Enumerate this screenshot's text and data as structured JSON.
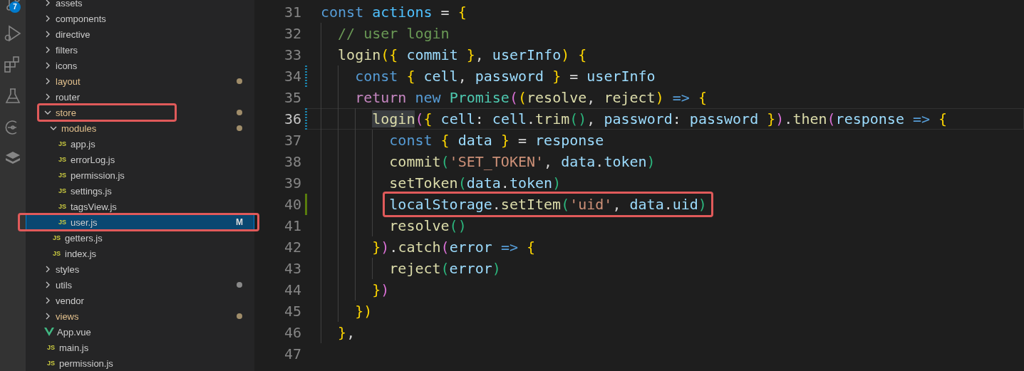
{
  "activity_bar": {
    "badge": "7"
  },
  "explorer": {
    "items": [
      {
        "name": "assets",
        "kind": "folder",
        "expanded": false,
        "modified": false,
        "dot": false,
        "selected": false,
        "annotated": false
      },
      {
        "name": "components",
        "kind": "folder",
        "expanded": false,
        "modified": false,
        "dot": false,
        "selected": false,
        "annotated": false
      },
      {
        "name": "directive",
        "kind": "folder",
        "expanded": false,
        "modified": false,
        "dot": false,
        "selected": false,
        "annotated": false
      },
      {
        "name": "filters",
        "kind": "folder",
        "expanded": false,
        "modified": false,
        "dot": false,
        "selected": false,
        "annotated": false
      },
      {
        "name": "icons",
        "kind": "folder",
        "expanded": false,
        "modified": false,
        "dot": false,
        "selected": false,
        "annotated": false
      },
      {
        "name": "layout",
        "kind": "folder",
        "expanded": false,
        "modified": true,
        "dot": true,
        "selected": false,
        "annotated": false
      },
      {
        "name": "router",
        "kind": "folder",
        "expanded": false,
        "modified": false,
        "dot": false,
        "selected": false,
        "annotated": false
      },
      {
        "name": "store",
        "kind": "folder",
        "expanded": true,
        "modified": true,
        "dot": true,
        "selected": false,
        "annotated": true,
        "children": [
          {
            "name": "modules",
            "kind": "folder",
            "expanded": true,
            "modified": true,
            "dot": true,
            "selected": false,
            "annotated": false,
            "children": [
              {
                "name": "app.js",
                "kind": "js",
                "icon_label": "JS",
                "modified": false,
                "dot": false,
                "selected": false,
                "annotated": false
              },
              {
                "name": "errorLog.js",
                "kind": "js",
                "icon_label": "JS",
                "modified": false,
                "dot": false,
                "selected": false,
                "annotated": false
              },
              {
                "name": "permission.js",
                "kind": "js",
                "icon_label": "JS",
                "modified": false,
                "dot": false,
                "selected": false,
                "annotated": false
              },
              {
                "name": "settings.js",
                "kind": "js",
                "icon_label": "JS",
                "modified": false,
                "dot": false,
                "selected": false,
                "annotated": false
              },
              {
                "name": "tagsView.js",
                "kind": "js",
                "icon_label": "JS",
                "modified": false,
                "dot": false,
                "selected": false,
                "annotated": false
              },
              {
                "name": "user.js",
                "kind": "js",
                "icon_label": "JS",
                "modified": false,
                "dot": false,
                "selected": true,
                "annotated": true,
                "badge": "M"
              }
            ]
          },
          {
            "name": "getters.js",
            "kind": "js",
            "icon_label": "JS",
            "modified": false,
            "dot": false,
            "selected": false,
            "annotated": false
          },
          {
            "name": "index.js",
            "kind": "js",
            "icon_label": "JS",
            "modified": false,
            "dot": false,
            "selected": false,
            "annotated": false
          }
        ]
      },
      {
        "name": "styles",
        "kind": "folder",
        "expanded": false,
        "modified": false,
        "dot": false,
        "selected": false,
        "annotated": false
      },
      {
        "name": "utils",
        "kind": "folder",
        "expanded": false,
        "modified": false,
        "dot": true,
        "selected": false,
        "annotated": false
      },
      {
        "name": "vendor",
        "kind": "folder",
        "expanded": false,
        "modified": false,
        "dot": false,
        "selected": false,
        "annotated": false
      },
      {
        "name": "views",
        "kind": "folder",
        "expanded": false,
        "modified": true,
        "dot": true,
        "selected": false,
        "annotated": false
      },
      {
        "name": "App.vue",
        "kind": "vue",
        "modified": false,
        "dot": false,
        "selected": false,
        "annotated": false
      },
      {
        "name": "main.js",
        "kind": "js",
        "icon_label": "JS",
        "modified": false,
        "dot": false,
        "selected": false,
        "annotated": false
      },
      {
        "name": "permission.js",
        "kind": "js",
        "icon_label": "JS",
        "modified": false,
        "dot": false,
        "selected": false,
        "annotated": false
      }
    ]
  },
  "editor": {
    "lines": [
      {
        "number": "31",
        "gutter_modified": false,
        "gutter_added": false,
        "current": false,
        "boxed": false,
        "tokens": [
          {
            "text": "const ",
            "kind": "kw"
          },
          {
            "text": "actions",
            "kind": "cst"
          },
          {
            "text": " = ",
            "kind": "p"
          },
          {
            "text": "{",
            "kind": "b1"
          }
        ]
      },
      {
        "number": "32",
        "gutter_modified": false,
        "gutter_added": false,
        "current": false,
        "boxed": false,
        "tokens": [
          {
            "text": "  // user login",
            "kind": "cmt"
          }
        ]
      },
      {
        "number": "33",
        "gutter_modified": false,
        "gutter_added": false,
        "current": false,
        "boxed": false,
        "tokens": [
          {
            "text": "  login",
            "kind": "fn"
          },
          {
            "text": "({ ",
            "kind": "b1"
          },
          {
            "text": "commit",
            "kind": "var"
          },
          {
            "text": " }",
            "kind": "b1"
          },
          {
            "text": ", ",
            "kind": "p"
          },
          {
            "text": "userInfo",
            "kind": "var"
          },
          {
            "text": ") {",
            "kind": "b1"
          }
        ]
      },
      {
        "number": "34",
        "gutter_modified": true,
        "gutter_added": false,
        "current": false,
        "boxed": false,
        "tokens": [
          {
            "text": "    const ",
            "kind": "kw"
          },
          {
            "text": "{ ",
            "kind": "b1"
          },
          {
            "text": "cell",
            "kind": "var"
          },
          {
            "text": ", ",
            "kind": "p"
          },
          {
            "text": "password ",
            "kind": "var"
          },
          {
            "text": "}",
            "kind": "b1"
          },
          {
            "text": " = ",
            "kind": "p"
          },
          {
            "text": "userInfo",
            "kind": "var"
          }
        ]
      },
      {
        "number": "35",
        "gutter_modified": false,
        "gutter_added": false,
        "current": false,
        "boxed": false,
        "tokens": [
          {
            "text": "    return ",
            "kind": "ctrl"
          },
          {
            "text": "new ",
            "kind": "kw"
          },
          {
            "text": "Promise",
            "kind": "cls"
          },
          {
            "text": "(",
            "kind": "b2"
          },
          {
            "text": "(",
            "kind": "b1"
          },
          {
            "text": "resolve",
            "kind": "fn"
          },
          {
            "text": ", ",
            "kind": "p"
          },
          {
            "text": "reject",
            "kind": "fn"
          },
          {
            "text": ") ",
            "kind": "b1"
          },
          {
            "text": "=> ",
            "kind": "kw"
          },
          {
            "text": "{",
            "kind": "b1"
          }
        ]
      },
      {
        "number": "36",
        "gutter_modified": true,
        "gutter_added": false,
        "current": true,
        "boxed": false,
        "tokens": [
          {
            "text": "      login",
            "kind": "fn",
            "highlight": true
          },
          {
            "text": "(",
            "kind": "b2"
          },
          {
            "text": "{ ",
            "kind": "b1"
          },
          {
            "text": "cell",
            "kind": "var"
          },
          {
            "text": ": ",
            "kind": "p"
          },
          {
            "text": "cell",
            "kind": "var"
          },
          {
            "text": ".",
            "kind": "p"
          },
          {
            "text": "trim",
            "kind": "fn"
          },
          {
            "text": "()",
            "kind": "b3"
          },
          {
            "text": ", ",
            "kind": "p"
          },
          {
            "text": "password",
            "kind": "var"
          },
          {
            "text": ": ",
            "kind": "p"
          },
          {
            "text": "password ",
            "kind": "var"
          },
          {
            "text": "}",
            "kind": "b1"
          },
          {
            "text": ")",
            "kind": "b2"
          },
          {
            "text": ".",
            "kind": "p"
          },
          {
            "text": "then",
            "kind": "fn"
          },
          {
            "text": "(",
            "kind": "b2"
          },
          {
            "text": "response ",
            "kind": "var"
          },
          {
            "text": "=> ",
            "kind": "kw"
          },
          {
            "text": "{",
            "kind": "b1"
          }
        ]
      },
      {
        "number": "37",
        "gutter_modified": false,
        "gutter_added": false,
        "current": false,
        "boxed": false,
        "tokens": [
          {
            "text": "        const ",
            "kind": "kw"
          },
          {
            "text": "{ ",
            "kind": "b1"
          },
          {
            "text": "data ",
            "kind": "var"
          },
          {
            "text": "}",
            "kind": "b1"
          },
          {
            "text": " = ",
            "kind": "p"
          },
          {
            "text": "response",
            "kind": "var"
          }
        ]
      },
      {
        "number": "38",
        "gutter_modified": false,
        "gutter_added": false,
        "current": false,
        "boxed": false,
        "tokens": [
          {
            "text": "        commit",
            "kind": "fn"
          },
          {
            "text": "(",
            "kind": "b3"
          },
          {
            "text": "'SET_TOKEN'",
            "kind": "str"
          },
          {
            "text": ", ",
            "kind": "p"
          },
          {
            "text": "data",
            "kind": "var"
          },
          {
            "text": ".",
            "kind": "p"
          },
          {
            "text": "token",
            "kind": "var"
          },
          {
            "text": ")",
            "kind": "b3"
          }
        ]
      },
      {
        "number": "39",
        "gutter_modified": false,
        "gutter_added": false,
        "current": false,
        "boxed": false,
        "tokens": [
          {
            "text": "        setToken",
            "kind": "fn"
          },
          {
            "text": "(",
            "kind": "b3"
          },
          {
            "text": "data",
            "kind": "var"
          },
          {
            "text": ".",
            "kind": "p"
          },
          {
            "text": "token",
            "kind": "var"
          },
          {
            "text": ")",
            "kind": "b3"
          }
        ]
      },
      {
        "number": "40",
        "gutter_modified": false,
        "gutter_added": true,
        "current": false,
        "boxed": true,
        "tokens": [
          {
            "text": "        localStorage",
            "kind": "var"
          },
          {
            "text": ".",
            "kind": "p"
          },
          {
            "text": "setItem",
            "kind": "fn"
          },
          {
            "text": "(",
            "kind": "b3"
          },
          {
            "text": "'uid'",
            "kind": "str"
          },
          {
            "text": ", ",
            "kind": "p"
          },
          {
            "text": "data",
            "kind": "var"
          },
          {
            "text": ".",
            "kind": "p"
          },
          {
            "text": "uid",
            "kind": "var"
          },
          {
            "text": ")",
            "kind": "b3"
          }
        ]
      },
      {
        "number": "41",
        "gutter_modified": false,
        "gutter_added": false,
        "current": false,
        "boxed": false,
        "tokens": [
          {
            "text": "        resolve",
            "kind": "fn"
          },
          {
            "text": "()",
            "kind": "b3"
          }
        ]
      },
      {
        "number": "42",
        "gutter_modified": false,
        "gutter_added": false,
        "current": false,
        "boxed": false,
        "tokens": [
          {
            "text": "      }",
            "kind": "b1"
          },
          {
            "text": ")",
            "kind": "b2"
          },
          {
            "text": ".",
            "kind": "p"
          },
          {
            "text": "catch",
            "kind": "fn"
          },
          {
            "text": "(",
            "kind": "b2"
          },
          {
            "text": "error ",
            "kind": "var"
          },
          {
            "text": "=> ",
            "kind": "kw"
          },
          {
            "text": "{",
            "kind": "b1"
          }
        ]
      },
      {
        "number": "43",
        "gutter_modified": false,
        "gutter_added": false,
        "current": false,
        "boxed": false,
        "tokens": [
          {
            "text": "        reject",
            "kind": "fn"
          },
          {
            "text": "(",
            "kind": "b3"
          },
          {
            "text": "error",
            "kind": "var"
          },
          {
            "text": ")",
            "kind": "b3"
          }
        ]
      },
      {
        "number": "44",
        "gutter_modified": false,
        "gutter_added": false,
        "current": false,
        "boxed": false,
        "tokens": [
          {
            "text": "      }",
            "kind": "b1"
          },
          {
            "text": ")",
            "kind": "b2"
          }
        ]
      },
      {
        "number": "45",
        "gutter_modified": false,
        "gutter_added": false,
        "current": false,
        "boxed": false,
        "tokens": [
          {
            "text": "    })",
            "kind": "b1"
          }
        ]
      },
      {
        "number": "46",
        "gutter_modified": false,
        "gutter_added": false,
        "current": false,
        "boxed": false,
        "tokens": [
          {
            "text": "  }",
            "kind": "b1"
          },
          {
            "text": ",",
            "kind": "p"
          }
        ]
      },
      {
        "number": "47",
        "gutter_modified": false,
        "gutter_added": false,
        "current": false
      }
    ]
  }
}
